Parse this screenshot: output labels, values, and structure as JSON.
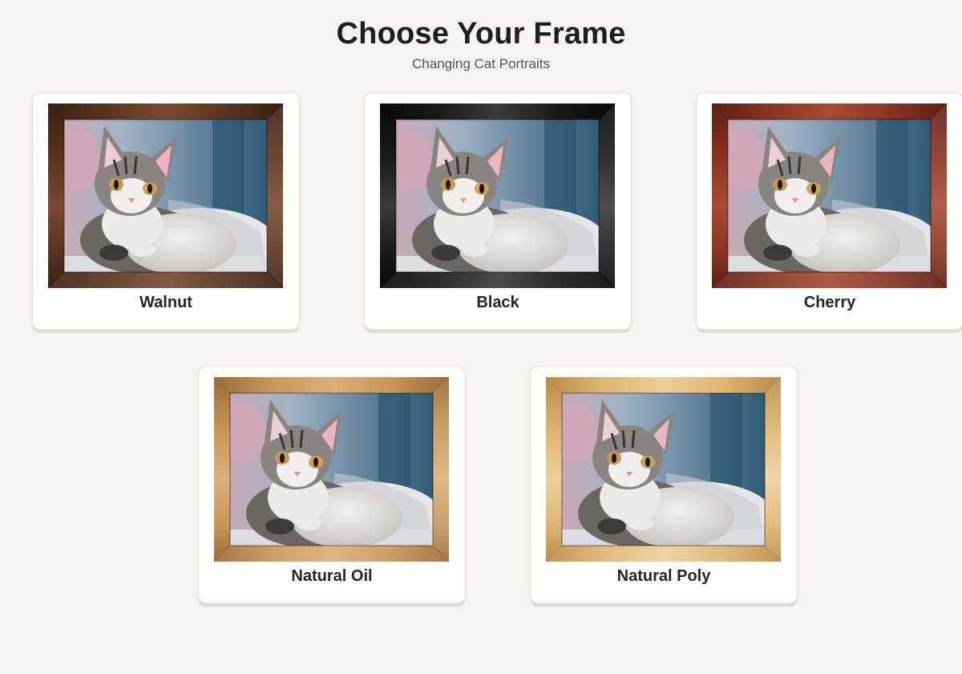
{
  "page": {
    "title": "Choose Your Frame",
    "subtitle": "Changing Cat Portraits"
  },
  "frames": [
    {
      "label": "Walnut",
      "color": "#5a3420",
      "dark": "#3a2012",
      "light": "#7a4a30"
    },
    {
      "label": "Black",
      "color": "#1a1a1a",
      "dark": "#080808",
      "light": "#3a3a3a"
    },
    {
      "label": "Cherry",
      "color": "#8a3422",
      "dark": "#5e1f12",
      "light": "#a84a34"
    },
    {
      "label": "Natural Oil",
      "color": "#c89658",
      "dark": "#9c6c36",
      "light": "#dcb07a"
    },
    {
      "label": "Natural Poly",
      "color": "#dfb672",
      "dark": "#b98c48",
      "light": "#ecd098"
    }
  ],
  "photo": {
    "subject": "tabby kitten portrait",
    "bg_color": "#6f8ea6",
    "blanket_color": "#e8e8ec"
  }
}
